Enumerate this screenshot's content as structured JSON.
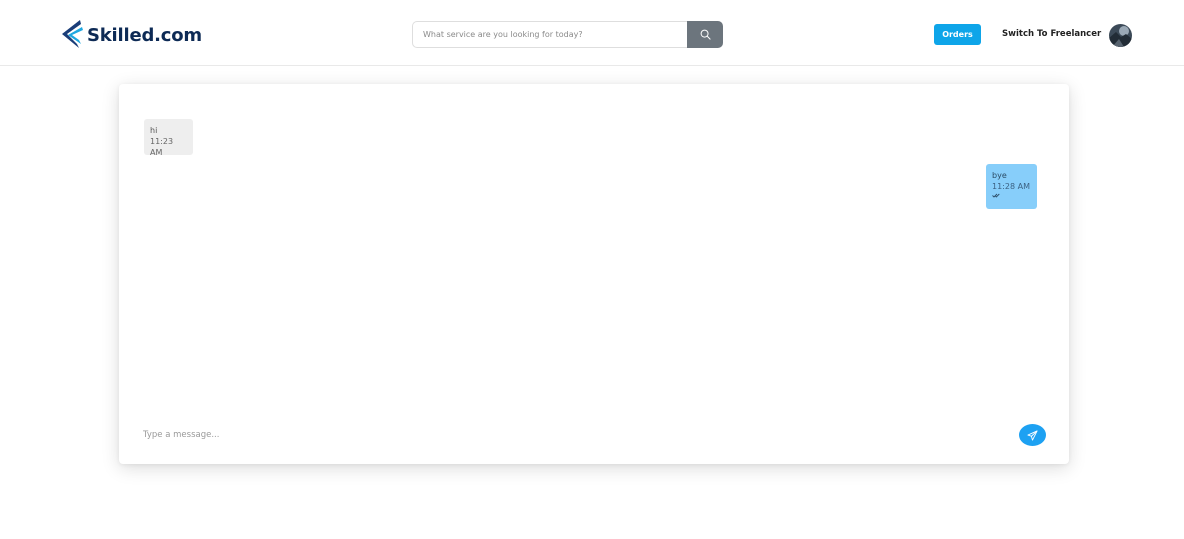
{
  "header": {
    "logo": {
      "text": "Skilled.com",
      "icon": "feather-swoosh-logo",
      "color": "#0d2a55",
      "accent": "#1ea7e0"
    },
    "search": {
      "placeholder": "What service are you looking for today?",
      "value": "",
      "icon": "search-icon"
    },
    "orders_label": "Orders",
    "switch_label": "Switch To Freelancer",
    "avatar": {
      "icon": "user-avatar"
    }
  },
  "chat": {
    "messages": [
      {
        "direction": "incoming",
        "text": "hi",
        "time": "11:23 AM"
      },
      {
        "direction": "outgoing",
        "text": "bye",
        "time": "11:28 AM",
        "status_icon": "double-check-icon"
      }
    ],
    "composer": {
      "placeholder": "Type a message...",
      "value": "",
      "send_icon": "paper-plane-icon"
    }
  },
  "colors": {
    "primary": "#0ea5e9",
    "search_button": "#6c757d",
    "incoming_bubble": "#eeeeee",
    "outgoing_bubble": "#87cefa",
    "send_button": "#1da1f2"
  }
}
